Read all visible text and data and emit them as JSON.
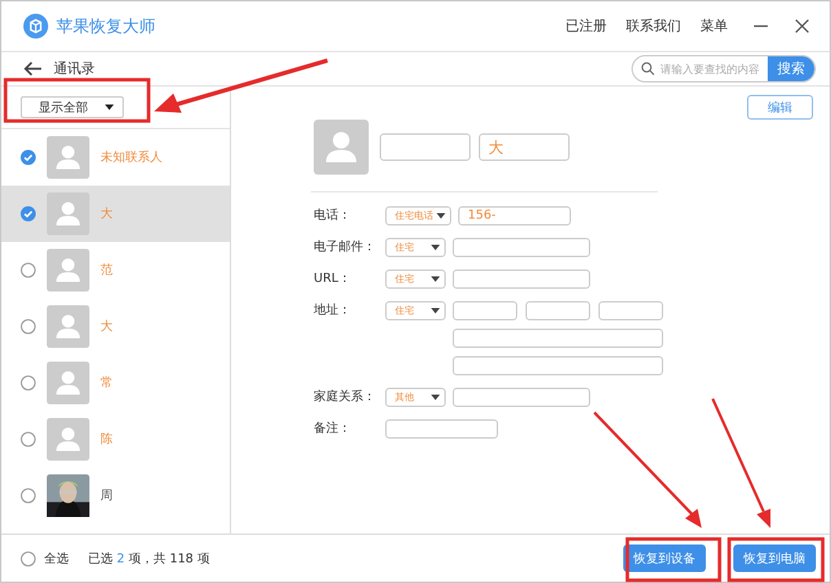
{
  "app": {
    "title": "苹果恢复大师",
    "nav": [
      "已注册",
      "联系我们",
      "菜单"
    ]
  },
  "header": {
    "title": "通讯录",
    "search": {
      "placeholder": "请输入要查找的内容",
      "button": "搜索"
    }
  },
  "filter": {
    "value": "显示全部"
  },
  "contacts": [
    {
      "name": "未知联系人",
      "checked": true,
      "selected": false,
      "kind": "silhouette"
    },
    {
      "name": "大",
      "checked": true,
      "selected": true,
      "kind": "silhouette"
    },
    {
      "name": "范",
      "checked": false,
      "selected": false,
      "kind": "silhouette"
    },
    {
      "name": "大",
      "checked": false,
      "selected": false,
      "kind": "silhouette"
    },
    {
      "name": "常",
      "checked": false,
      "selected": false,
      "kind": "silhouette"
    },
    {
      "name": "陈",
      "checked": false,
      "selected": false,
      "kind": "silhouette"
    },
    {
      "name": "周",
      "checked": false,
      "selected": false,
      "kind": "picture"
    }
  ],
  "edit_button": "编辑",
  "detail": {
    "last_name": "大",
    "fields": [
      {
        "label": "电话：",
        "kind": "select",
        "type": "住宅电话",
        "value": "156-"
      },
      {
        "label": "电子邮件：",
        "kind": "select",
        "type": "住宅"
      },
      {
        "label": "URL：",
        "kind": "select",
        "type": "住宅"
      },
      {
        "label": "地址：",
        "kind": "address",
        "type": "住宅"
      },
      {
        "label": "家庭关系：",
        "kind": "select",
        "type": "其他"
      },
      {
        "label": "备注：",
        "kind": "note"
      }
    ]
  },
  "footer": {
    "select_all": {
      "label": "全选",
      "checked": false
    },
    "status_before": "已选",
    "selected_count": "2",
    "status_after": "项，共 118 项",
    "buttons": [
      "恢复到设备",
      "恢复到电脑"
    ]
  }
}
